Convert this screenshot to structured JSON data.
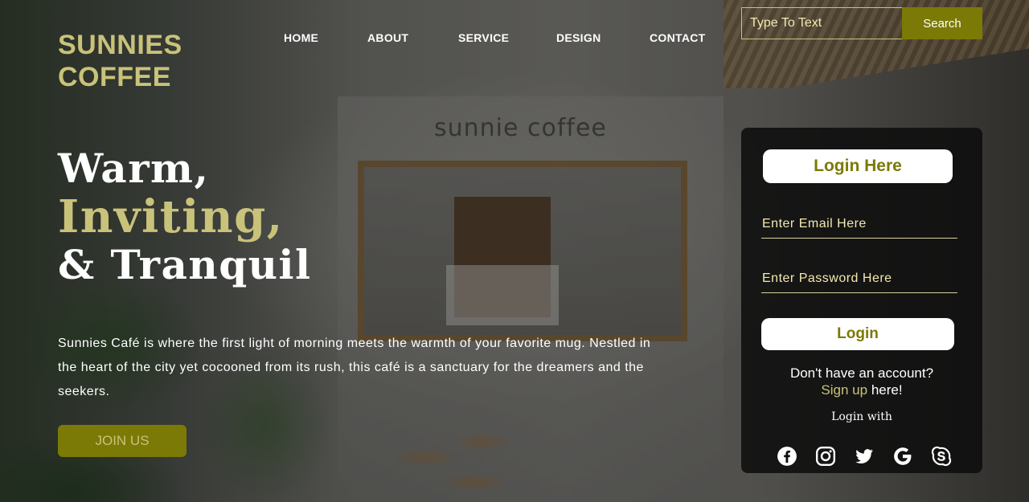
{
  "brand": {
    "line1": "SUNNIES",
    "line2": "COFFEE"
  },
  "nav": {
    "items": [
      {
        "label": "HOME"
      },
      {
        "label": "ABOUT"
      },
      {
        "label": "SERVICE"
      },
      {
        "label": "DESIGN"
      },
      {
        "label": "CONTACT"
      }
    ]
  },
  "search": {
    "placeholder": "Type To Text",
    "button_label": "Search"
  },
  "hero": {
    "line1": "Warm,",
    "line2": "Inviting,",
    "line3": "& Tranquil",
    "paragraph": "Sunnies Café is where the first light of morning meets the warmth of your favorite mug. Nestled in the heart of the city yet cocooned from its rush, this café is a sanctuary for the dreamers and the seekers.",
    "join_label": "JOIN US"
  },
  "background_sign": "sunnie coffee",
  "login": {
    "title": "Login Here",
    "email_placeholder": "Enter Email Here",
    "password_placeholder": "Enter Password Here",
    "button_label": "Login",
    "no_account_text": "Don't have an account?",
    "signup_link": "Sign up",
    "signup_suffix": " here!",
    "login_with": "Login with",
    "social_icons": [
      "facebook-icon",
      "instagram-icon",
      "twitter-icon",
      "google-icon",
      "skype-icon"
    ]
  },
  "colors": {
    "accent": "#c9c27a",
    "button_olive": "#7b7a06",
    "panel_bg": "#0e0e0e"
  }
}
